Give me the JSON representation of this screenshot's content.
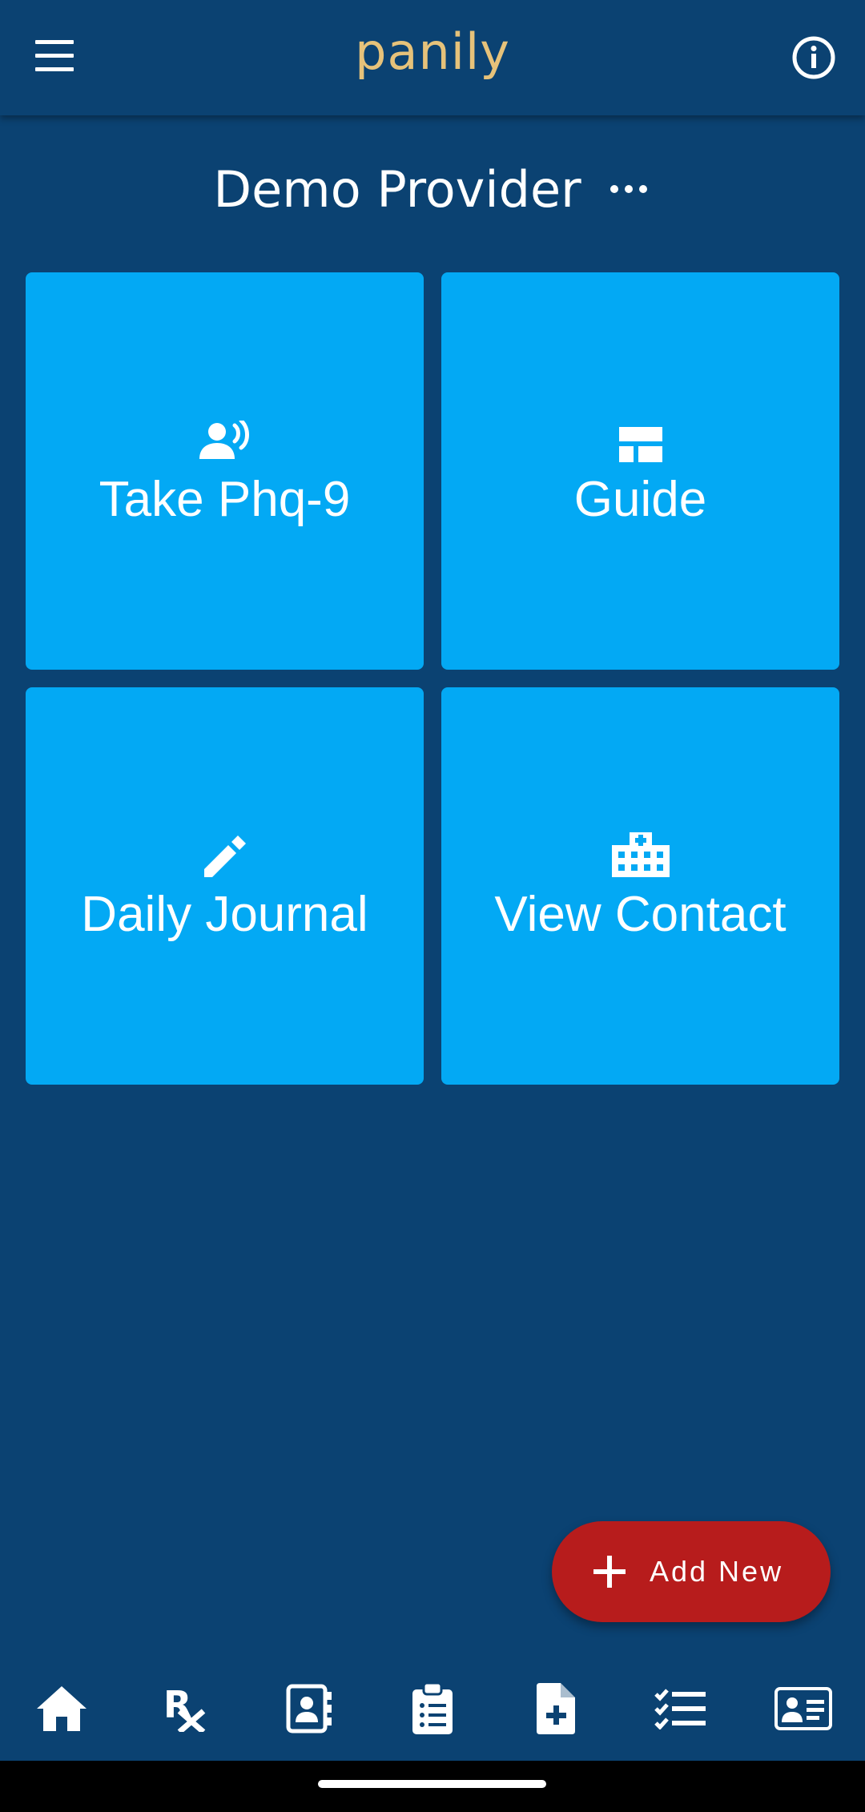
{
  "app": {
    "title": "panily"
  },
  "colors": {
    "background": "#0b4272",
    "tile": "#03a9f4",
    "brand": "#e6c27a",
    "fab": "#b71c1c"
  },
  "header": {
    "provider_name": "Demo Provider"
  },
  "tiles": [
    {
      "label": "Take Phq-9",
      "icon": "record-voice-icon"
    },
    {
      "label": "Guide",
      "icon": "web-layout-icon"
    },
    {
      "label": "Daily Journal",
      "icon": "pencil-icon"
    },
    {
      "label": "View Contact",
      "icon": "hospital-building-icon"
    }
  ],
  "fab": {
    "label": "Add New",
    "icon": "plus-icon"
  },
  "bottom_nav": [
    {
      "icon": "home-icon"
    },
    {
      "icon": "rx-prescription-icon",
      "text": "R"
    },
    {
      "icon": "contact-book-icon"
    },
    {
      "icon": "clipboard-list-icon"
    },
    {
      "icon": "medical-file-icon"
    },
    {
      "icon": "checklist-icon"
    },
    {
      "icon": "id-card-icon"
    }
  ]
}
